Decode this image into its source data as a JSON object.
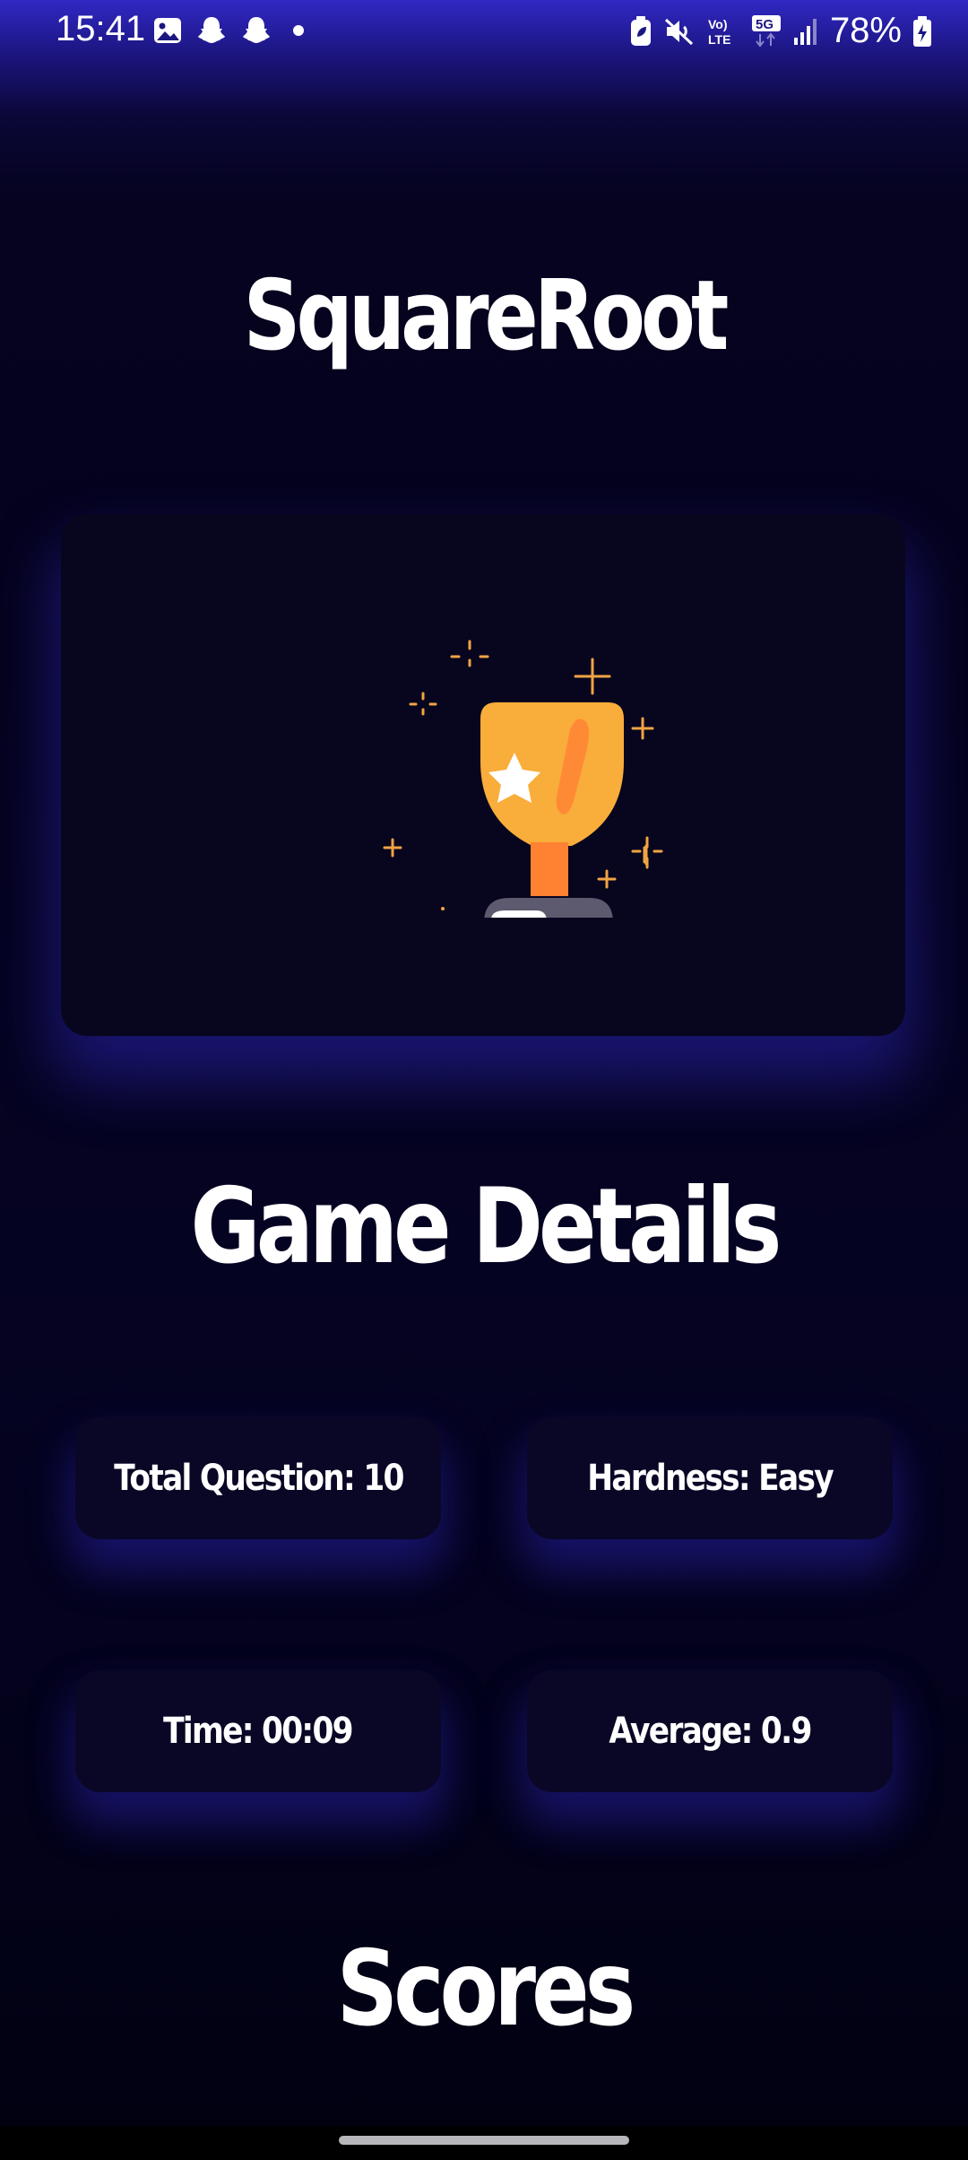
{
  "status_bar": {
    "time": "15:41",
    "left_icons": [
      "gallery-icon",
      "snapchat-icon",
      "snapchat-icon",
      "dot-icon"
    ],
    "right_icons": [
      "battery-saver-icon",
      "mute-icon",
      "volte-icon",
      "5g-icon",
      "signal-icon"
    ],
    "network_volte": "Vo) LTE",
    "network_5g": "5G",
    "battery_percent": "78%"
  },
  "app": {
    "title": "SquareRoot"
  },
  "trophy": {
    "icon": "trophy-icon"
  },
  "game_details": {
    "heading": "Game Details",
    "total_question": "Total Question: 10",
    "hardness": "Hardness: Easy",
    "time": "Time: 00:09",
    "average": "Average: 0.9"
  },
  "scores": {
    "heading": "Scores"
  },
  "colors": {
    "accent": "#3a31d6",
    "card_bg": "#0a0726",
    "trophy_cup": "#f9ad3a",
    "trophy_stem": "#ff8132",
    "trophy_base": "#5d5a70"
  }
}
